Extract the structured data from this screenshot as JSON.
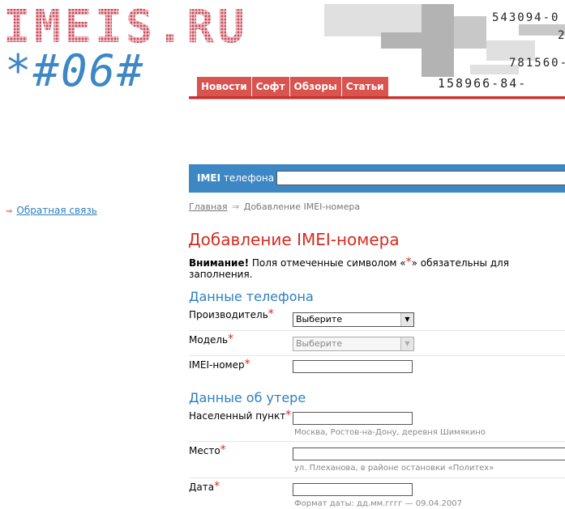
{
  "header": {
    "logo": "IMEIS.RU",
    "code": "*#06#",
    "numbers": [
      "543094-0",
      "2",
      "781560-",
      "158966-84-"
    ]
  },
  "nav": [
    "Новости",
    "Софт",
    "Обзоры",
    "Статьи"
  ],
  "sidebar": {
    "feedback_arrow": "⇒",
    "feedback": "Обратная связь"
  },
  "search": {
    "label_bold": "IMEI",
    "label_rest": " телефона",
    "value": ""
  },
  "breadcrumb": {
    "home": "Главная",
    "sep": "⇒",
    "current": "Добавление IMEI-номера"
  },
  "page": {
    "title": "Добавление IMEI-номера",
    "notice_bold": "Внимание!",
    "notice_pre": " Поля отмеченные символом «",
    "notice_star": "*",
    "notice_post": "» обязательны для заполнения."
  },
  "sections": {
    "phone": "Данные телефона",
    "loss": "Данные об утере"
  },
  "fields": {
    "manufacturer": {
      "label": "Производитель",
      "value": "Выберите"
    },
    "model": {
      "label": "Модель",
      "value": "Выберите"
    },
    "imei": {
      "label": "IMEI-номер",
      "value": ""
    },
    "locality": {
      "label": "Населенный пункт",
      "value": "",
      "hint": "Москва, Ростов-на-Дону, деревня Шимякино"
    },
    "place": {
      "label": "Место",
      "value": "",
      "hint": "ул. Плеханова, в районе остановки «Политех»"
    },
    "date": {
      "label": "Дата",
      "value": "",
      "hint": "Формат даты: дд.мм.гггг — 09.04.2007"
    }
  },
  "required_mark": "*",
  "colors": {
    "accent_red": "#d52b1e",
    "nav_red": "#d9534f",
    "accent_blue": "#3d87c5"
  }
}
